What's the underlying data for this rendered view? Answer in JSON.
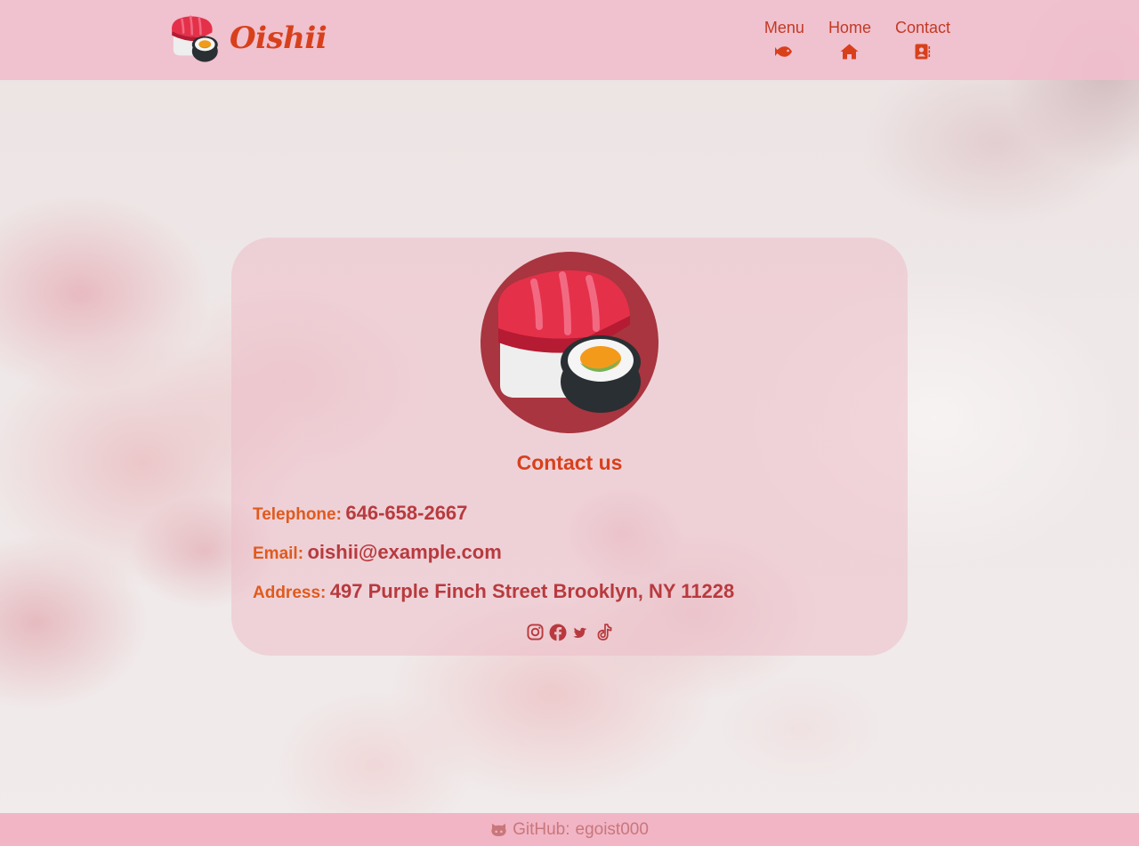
{
  "brand": {
    "name": "Oishii",
    "logo_icon": "sushi-icon"
  },
  "nav": [
    {
      "label": "Menu",
      "icon": "fish-icon"
    },
    {
      "label": "Home",
      "icon": "home-icon"
    },
    {
      "label": "Contact",
      "icon": "address-book-icon"
    }
  ],
  "contact": {
    "title": "Contact us",
    "telephone_label": "Telephone:",
    "telephone": "646-658-2667",
    "email_label": "Email:",
    "email": "oishii@example.com",
    "address_label": "Address:",
    "address": "497 Purple Finch Street Brooklyn, NY 11228",
    "socials": [
      "instagram-icon",
      "facebook-icon",
      "twitter-icon",
      "tiktok-icon"
    ]
  },
  "footer": {
    "label": "GitHub:",
    "username": "egoist000",
    "icon": "github-icon"
  },
  "colors": {
    "header_bg": "#f0bfcd",
    "accent": "#d8401c",
    "value_text": "#b83a3e",
    "card_bg": "#ecbec8",
    "footer_bg": "#f0b2c4",
    "footer_text": "#c9777a"
  }
}
